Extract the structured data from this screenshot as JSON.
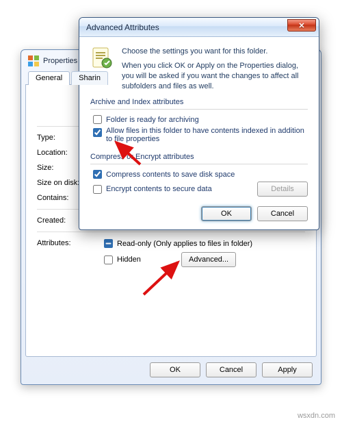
{
  "properties": {
    "title": "Properties",
    "tabs": {
      "general": "General",
      "sharing": "Sharin"
    },
    "fields": {
      "type": "Type:",
      "location": "Location:",
      "size": "Size:",
      "size_on_disk": "Size on disk:",
      "contains": "Contains:",
      "created": "Created:",
      "attributes": "Attributes:"
    },
    "attributes": {
      "readonly_label": "Read-only (Only applies to files in folder)",
      "hidden_label": "Hidden",
      "advanced_button": "Advanced..."
    },
    "buttons": {
      "ok": "OK",
      "cancel": "Cancel",
      "apply": "Apply"
    }
  },
  "advanced": {
    "title": "Advanced Attributes",
    "intro_line1": "Choose the settings you want for this folder.",
    "intro_line2": "When you click OK or Apply on the Properties dialog, you will be asked if you want the changes to affect all subfolders and files as well.",
    "archive_group": {
      "legend": "Archive and Index attributes",
      "ready_label": "Folder is ready for archiving",
      "index_label": "Allow files in this folder to have contents indexed in addition to file properties"
    },
    "compress_group": {
      "legend": "Compress or Encrypt attributes",
      "compress_label": "Compress contents to save disk space",
      "encrypt_label": "Encrypt contents to secure data",
      "details_button": "Details"
    },
    "buttons": {
      "ok": "OK",
      "cancel": "Cancel"
    }
  },
  "watermark": "wsxdn.com"
}
